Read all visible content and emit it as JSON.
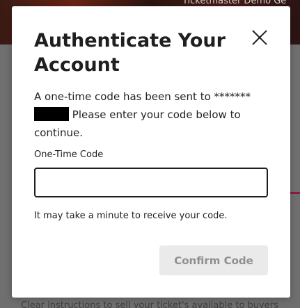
{
  "background": {
    "header_text": "Ticketmaster Demo   Ge",
    "footer_text": "Clear instructions to sell your ticket's available to buyers"
  },
  "modal": {
    "title": "Authenticate Your Account",
    "close_icon": "close-icon",
    "message_prefix": "A one-time code has been sent to *******",
    "message_suffix": " Please enter your code below to continue.",
    "code_label": "One-Time Code",
    "code_value": "",
    "hint": "It may take a minute to receive your code.",
    "confirm_label": "Confirm Code"
  },
  "colors": {
    "accent": "#8a1f3a",
    "disabled_button_bg": "#eaeaea",
    "disabled_button_text": "#8f8f8f"
  }
}
